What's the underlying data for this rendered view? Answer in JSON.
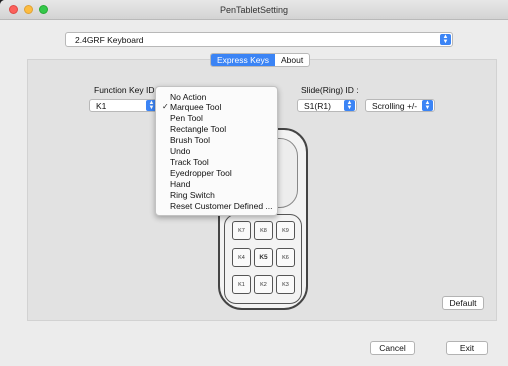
{
  "window": {
    "title": "PenTabletSetting"
  },
  "device_select": {
    "value": "2.4GRF Keyboard"
  },
  "tabs": [
    {
      "label": "Express Keys",
      "active": true
    },
    {
      "label": "About",
      "active": false
    }
  ],
  "function_key": {
    "label": "Function Key ID",
    "value": "K1"
  },
  "slide_ring": {
    "label": "Slide(Ring) ID :",
    "value": "S1(R1)",
    "action": "Scrolling +/-"
  },
  "menu": {
    "items": [
      "No Action",
      "Marquee Tool",
      "Pen Tool",
      "Rectangle Tool",
      "Brush Tool",
      "Undo",
      "Track Tool",
      "Eyedropper Tool",
      "Hand",
      "Ring Switch",
      "Reset Customer Defined ..."
    ],
    "checked": "Marquee Tool",
    "checkmark": "✓"
  },
  "keys": {
    "k7": "K7",
    "k8": "K8",
    "k9": "K9",
    "k4": "K4",
    "k5": "K5",
    "k6": "K6",
    "k1": "K1",
    "k2": "K2",
    "k3": "K3"
  },
  "buttons": {
    "default": "Default",
    "cancel": "Cancel",
    "exit": "Exit"
  },
  "colors": {
    "accent": "#3b84f5",
    "panel": "#e2e2e2"
  }
}
